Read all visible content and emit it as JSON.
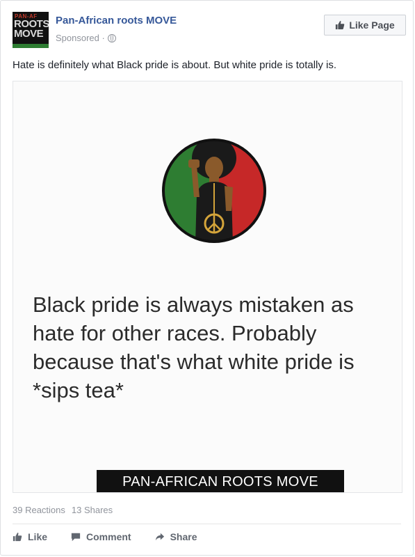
{
  "post": {
    "page_name": "Pan-African roots MOVE",
    "sponsored_label": "Sponsored ·",
    "like_page_label": "Like Page",
    "text": "Hate is definitely what Black pride is about. But white pride is totally is.",
    "avatar": {
      "line1": "ROOTS",
      "line2": "MOVE"
    }
  },
  "image": {
    "meme_text": "Black pride is always mistaken as hate for other races. Probably because that's what white pride is *sips tea*",
    "brand_bar": "PAN-AFRICAN ROOTS MOVE"
  },
  "stats": {
    "reactions": "39 Reactions",
    "shares": "13 Shares"
  },
  "actions": {
    "like": "Like",
    "comment": "Comment",
    "share": "Share"
  },
  "colors": {
    "link_blue": "#365899",
    "meta_gray": "#90949c",
    "emblem_green": "#2e7d32",
    "emblem_red": "#c62828",
    "emblem_black": "#111111"
  }
}
